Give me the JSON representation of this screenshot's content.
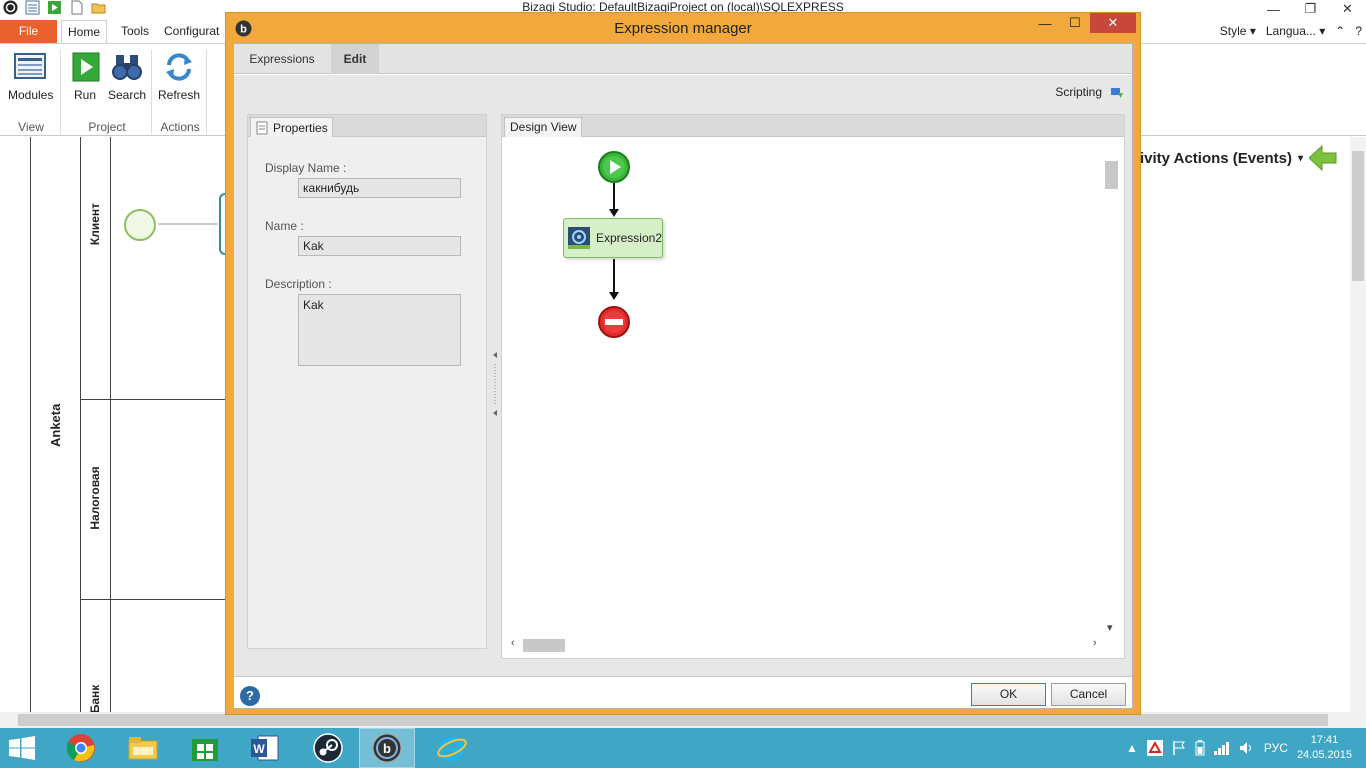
{
  "app": {
    "title": "Bizagi Studio: DefaultBizagiProject on (local)\\SQLEXPRESS"
  },
  "ribbon": {
    "tabs": [
      "File",
      "Home",
      "Tools",
      "Configurat"
    ],
    "right_items": [
      "Style",
      "Langua..."
    ],
    "buttons": {
      "modules": "Modules",
      "run": "Run",
      "search": "Search",
      "refresh": "Refresh"
    },
    "groups": {
      "view": "View",
      "project": "Project",
      "actions": "Actions"
    }
  },
  "background": {
    "pool_label": "Anketa",
    "lanes": [
      "Клиент",
      "Налоговая",
      "Банк"
    ],
    "activity_actions": "ivity Actions (Events)"
  },
  "dialog": {
    "title": "Expression manager",
    "tabs": {
      "expressions": "Expressions",
      "edit": "Edit"
    },
    "scripting_label": "Scripting",
    "properties": {
      "tab_label": "Properties",
      "display_name_label": "Display Name :",
      "display_name_value": "какнибудь",
      "name_label": "Name :",
      "name_value": "Kak",
      "description_label": "Description :",
      "description_value": "Kak"
    },
    "design_view": {
      "tab_label": "Design View",
      "task_label": "Expression2"
    },
    "footer": {
      "help": "?",
      "ok": "OK",
      "cancel": "Cancel"
    }
  },
  "taskbar": {
    "language": "РУС",
    "time": "17:41",
    "date": "24.05.2015"
  },
  "colors": {
    "file_tab": "#e8602c",
    "dialog_frame": "#f0a93a",
    "taskbar": "#3fa7c5",
    "close_button": "#c7473a",
    "task_fill": "#d5efc8"
  }
}
